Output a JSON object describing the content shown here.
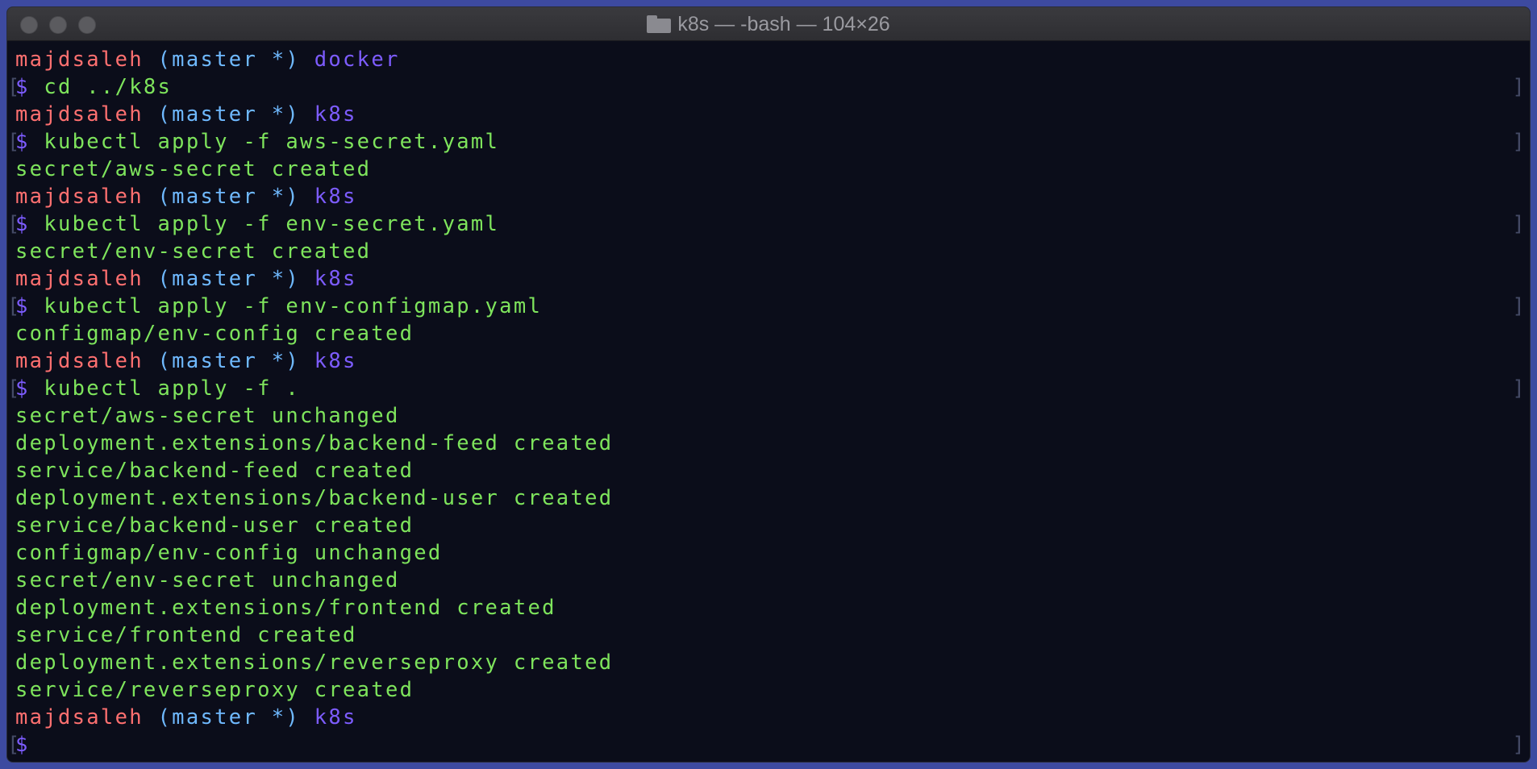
{
  "window": {
    "title": "k8s — -bash — 104×26",
    "title_icon": "folder-icon"
  },
  "colors": {
    "user": "#ff7070",
    "branch": "#6fb9ff",
    "dir": "#7d5cff",
    "output": "#7ee45c",
    "background": "#0b0d1a"
  },
  "terminal": {
    "lines": [
      {
        "type": "prompt",
        "user": "majdsaleh",
        "branch": "(master *)",
        "dir": "docker"
      },
      {
        "type": "command",
        "prefix": "$",
        "text": "cd ../k8s"
      },
      {
        "type": "prompt",
        "user": "majdsaleh",
        "branch": "(master *)",
        "dir": "k8s"
      },
      {
        "type": "command",
        "prefix": "$",
        "text": "kubectl apply -f aws-secret.yaml"
      },
      {
        "type": "output",
        "text": "secret/aws-secret created"
      },
      {
        "type": "prompt",
        "user": "majdsaleh",
        "branch": "(master *)",
        "dir": "k8s"
      },
      {
        "type": "command",
        "prefix": "$",
        "text": "kubectl apply -f env-secret.yaml"
      },
      {
        "type": "output",
        "text": "secret/env-secret created"
      },
      {
        "type": "prompt",
        "user": "majdsaleh",
        "branch": "(master *)",
        "dir": "k8s"
      },
      {
        "type": "command",
        "prefix": "$",
        "text": "kubectl apply -f env-configmap.yaml"
      },
      {
        "type": "output",
        "text": "configmap/env-config created"
      },
      {
        "type": "prompt",
        "user": "majdsaleh",
        "branch": "(master *)",
        "dir": "k8s"
      },
      {
        "type": "command",
        "prefix": "$",
        "text": "kubectl apply -f ."
      },
      {
        "type": "output",
        "text": "secret/aws-secret unchanged"
      },
      {
        "type": "output",
        "text": "deployment.extensions/backend-feed created"
      },
      {
        "type": "output",
        "text": "service/backend-feed created"
      },
      {
        "type": "output",
        "text": "deployment.extensions/backend-user created"
      },
      {
        "type": "output",
        "text": "service/backend-user created"
      },
      {
        "type": "output",
        "text": "configmap/env-config unchanged"
      },
      {
        "type": "output",
        "text": "secret/env-secret unchanged"
      },
      {
        "type": "output",
        "text": "deployment.extensions/frontend created"
      },
      {
        "type": "output",
        "text": "service/frontend created"
      },
      {
        "type": "output",
        "text": "deployment.extensions/reverseproxy created"
      },
      {
        "type": "output",
        "text": "service/reverseproxy created"
      },
      {
        "type": "prompt",
        "user": "majdsaleh",
        "branch": "(master *)",
        "dir": "k8s"
      },
      {
        "type": "command",
        "prefix": "$",
        "text": ""
      }
    ]
  }
}
